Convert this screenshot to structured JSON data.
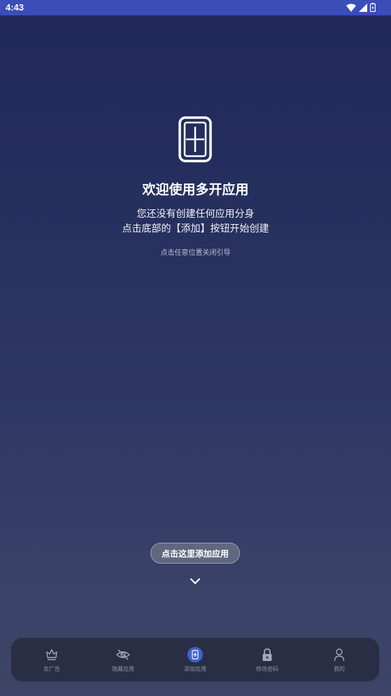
{
  "status_bar": {
    "time": "4:43",
    "icons": [
      "wifi-icon",
      "cell-signal-icon",
      "battery-icon"
    ]
  },
  "guide": {
    "icon": "phone-add-icon",
    "title": "欢迎使用多开应用",
    "line1": "您还没有创建任何应用分身",
    "line2": "点击底部的【添加】按钮开始创建",
    "dismiss_hint": "点击任意位置关闭引导"
  },
  "cta": {
    "label": "点击这里添加应用",
    "arrow_icon": "chevron-down-icon"
  },
  "bottom_nav": {
    "items": [
      {
        "label": "去广告",
        "icon": "crown-icon",
        "active": false
      },
      {
        "label": "隐藏应用",
        "icon": "eye-off-icon",
        "active": false
      },
      {
        "label": "添加应用",
        "icon": "add-app-icon",
        "active": true
      },
      {
        "label": "修改密码",
        "icon": "lock-icon",
        "active": false
      },
      {
        "label": "我的",
        "icon": "user-icon",
        "active": false
      }
    ]
  },
  "colors": {
    "status_bar_bg": "#3b4db8",
    "nav_active": "#3f63c9",
    "nav_label": "#8d91a6"
  }
}
